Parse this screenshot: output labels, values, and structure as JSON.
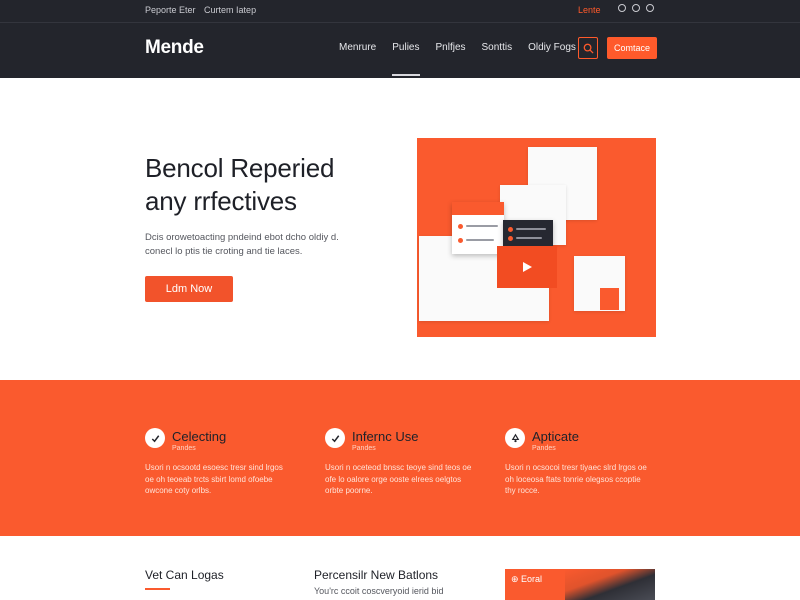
{
  "utility_bar": {
    "left_links": [
      "Peporte Eter",
      "Curtem Iatep"
    ],
    "right_link": "Lente",
    "icons": [
      "social-circle-icon",
      "social-circle-icon",
      "social-circle-icon"
    ]
  },
  "header": {
    "logo": "Mende",
    "nav": [
      {
        "label": "Menrure",
        "active": false
      },
      {
        "label": "Pulies",
        "active": true
      },
      {
        "label": "Pnlfjes",
        "active": false
      },
      {
        "label": "Sonttis",
        "active": false
      },
      {
        "label": "Oldiy Fogs",
        "active": false
      }
    ],
    "search_icon": "search-icon",
    "cta_label": "Comtace"
  },
  "hero": {
    "title_line1": "Bencol Reperied",
    "title_line2": "any rrfectives",
    "text_line1": "Dcis orowetoacting pndeind ebot dcho oldiy d.",
    "text_line2": "conecl lo ptis tie croting and tie laces.",
    "button_label": "Ldm Now",
    "art_icons": [
      "play-icon"
    ]
  },
  "features": [
    {
      "icon": "check-icon",
      "title": "Celecting",
      "subtitle": "Pandes",
      "text": "Usori n ocsootd esoesc tresr sind lrgos oe oh teoeab trcts sbirt lomd ofoebe owcone coty orlbs."
    },
    {
      "icon": "check-icon",
      "title": "Infernc Use",
      "subtitle": "Pandes",
      "text": "Usori n oceteod bnssc teoye sind teos oe ofe lo oalore orge ooste elrees oelgtos orbte poorne."
    },
    {
      "icon": "recycle-icon",
      "title": "Apticate",
      "subtitle": "Pandes",
      "text": "Usori n ocsocoi tresr tiyaec slrd lrgos oe oh loceosa ftats tonrie olegsos ccoptie thy rocce."
    }
  ],
  "bottom": {
    "col1_title": "Vet Can Logas",
    "col2_title": "Percensilr New Batlons",
    "col2_text": "You'rc ccoit coscveryoid ierid bid",
    "card_label": "⊕ Eoral"
  },
  "colors": {
    "accent": "#fa5a2e",
    "dark": "#23252c"
  }
}
